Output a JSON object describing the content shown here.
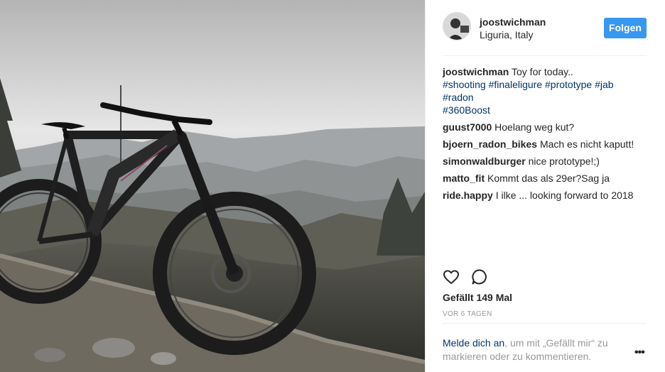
{
  "post": {
    "username": "joostwichman",
    "location": "Liguria, Italy",
    "follow_label": "Folgen",
    "caption": {
      "user": "joostwichman",
      "text": "Toy for today..",
      "hashtags_line1": [
        "#shooting",
        "#finaleligure",
        "#prototype",
        "#jab"
      ],
      "hashtags_line2": [
        "#radon"
      ],
      "hashtags_line3": [
        "#360Boost"
      ]
    },
    "comments": [
      {
        "user": "guust7000",
        "text": "Hoelang weg kut?"
      },
      {
        "user": "bjoern_radon_bikes",
        "text": "Mach es nicht kaputt!"
      },
      {
        "user": "simonwaldburger",
        "text": "nice prototype!;)"
      },
      {
        "user": "matto_fit",
        "text": "Kommt das als 29er?Sag ja"
      },
      {
        "user": "ride.happy",
        "text": "I ilke ... looking forward to 2018"
      }
    ],
    "likes_text": "Gefällt 149 Mal",
    "time_text": "VOR 6 TAGEN",
    "login_link": "Melde dich an",
    "login_text": ", um mit „Gefällt mir“ zu markieren oder zu kommentieren.",
    "more_label": "•••"
  },
  "icons": {
    "like": "heart-icon",
    "comment": "comment-icon",
    "more": "more-options-icon"
  },
  "colors": {
    "follow_button": "#3897f0",
    "hashtag": "#003569",
    "muted": "#999999"
  }
}
